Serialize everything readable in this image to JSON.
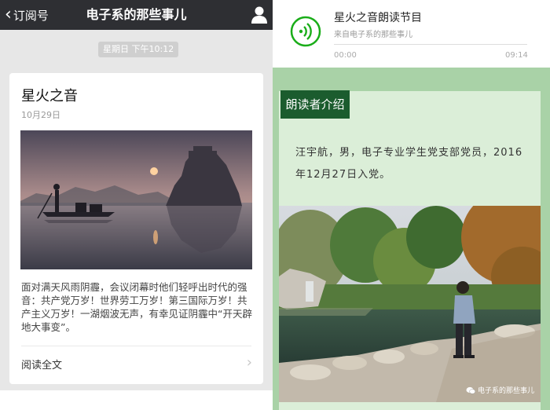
{
  "left": {
    "header": {
      "back_label": "订阅号",
      "title": "电子系的那些事儿",
      "back_icon": "chevron-left-icon",
      "profile_icon": "user-icon"
    },
    "timestamp": "星期日 下午10:12",
    "card": {
      "title": "星火之音",
      "date": "10月29日",
      "body": "面对满天风雨阴霾，会议闭幕时他们轻呼出时代的强音：共产党万岁！世界劳工万岁！第三国际万岁！共产主义万岁！一湖烟波无声，有幸见证阴霾中“开天辟地大事变”。",
      "read_all": "阅读全文"
    }
  },
  "right": {
    "audio": {
      "title": "星火之音朗读节目",
      "subtitle": "来自电子系的那些事儿",
      "current_time": "00:00",
      "duration": "09:14",
      "accent": "#1aad19"
    },
    "section_label": "朗读者介绍",
    "intro": "汪宇航，男，电子专业学生党支部党员，2016年12月27日入党。",
    "watermark": "电子系的那些事儿"
  },
  "colors": {
    "header_bg": "#2e2f33",
    "section_green": "#1b5c2e",
    "pale_green": "#dbeed8",
    "border_green": "#a9d2a7"
  }
}
